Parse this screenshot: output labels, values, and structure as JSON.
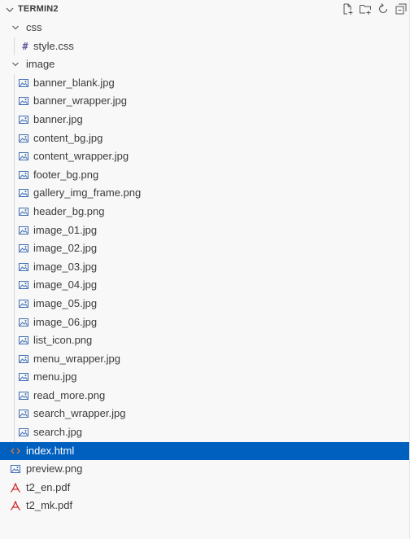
{
  "explorer": {
    "title": "TERMIN2",
    "actions": [
      "new-file-icon",
      "new-folder-icon",
      "refresh-icon",
      "collapse-all-icon"
    ],
    "folders": {
      "css": "css",
      "image": "image"
    },
    "css_files": [
      "style.css"
    ],
    "image_files": [
      "banner_blank.jpg",
      "banner_wrapper.jpg",
      "banner.jpg",
      "content_bg.jpg",
      "content_wrapper.jpg",
      "footer_bg.png",
      "gallery_img_frame.png",
      "header_bg.png",
      "image_01.jpg",
      "image_02.jpg",
      "image_03.jpg",
      "image_04.jpg",
      "image_05.jpg",
      "image_06.jpg",
      "list_icon.png",
      "menu_wrapper.jpg",
      "menu.jpg",
      "read_more.png",
      "search_wrapper.jpg",
      "search.jpg"
    ],
    "root_files": [
      {
        "name": "index.html",
        "icon": "html-file-icon",
        "selected": true
      },
      {
        "name": "preview.png",
        "icon": "image-file-icon",
        "selected": false
      },
      {
        "name": "t2_en.pdf",
        "icon": "pdf-file-icon",
        "selected": false
      },
      {
        "name": "t2_mk.pdf",
        "icon": "pdf-file-icon",
        "selected": false
      }
    ],
    "colors": {
      "selection": "#0060c0",
      "image_icon": "#3f6fb5",
      "pdf_icon": "#d3262c",
      "html_icon": "#e37933",
      "css_icon": "#6a5aa5"
    }
  }
}
